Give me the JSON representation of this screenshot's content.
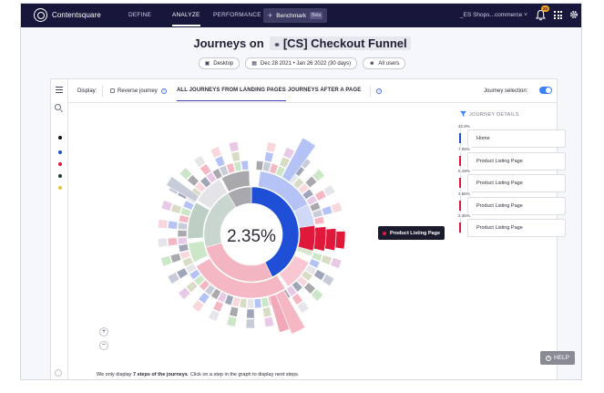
{
  "nav": {
    "brand": "Contentsquare",
    "items": [
      "DEFINE",
      "ANALYZE",
      "PERFORMANCE"
    ],
    "active": "ANALYZE",
    "benchmark": "Benchmark",
    "beta": "Beta",
    "project": "_ES Shops...commerce",
    "notification_count": "20"
  },
  "header": {
    "title_prefix": "Journeys on",
    "mapping": "[CS] Checkout Funnel",
    "filters": [
      {
        "icon": "desktop-icon",
        "label": "Desktop"
      },
      {
        "icon": "calendar-icon",
        "label": "Dec 28 2021 • Jan 26 2022 (30 days)"
      },
      {
        "icon": "users-icon",
        "label": "All users"
      }
    ]
  },
  "toolbar": {
    "display_label": "Display:",
    "reverse_label": "Reverse journey",
    "tabs": [
      "ALL JOURNEYS FROM LANDING PAGES",
      "JOURNEYS AFTER A PAGE"
    ],
    "journey_selection_label": "Journey selection:"
  },
  "colors": {
    "accent": "#3f3fb8",
    "home": "#1f4fd6",
    "product_listing": "#e0193b",
    "toggle": "#3b82f6"
  },
  "sunburst": {
    "center_value": "2.35%",
    "tooltip": "Product Listing Page"
  },
  "journey_details": {
    "title": "JOURNEY DETAILS",
    "steps": [
      {
        "pct": "42.8%",
        "label": "Home",
        "color": "#1f4fd6"
      },
      {
        "pct": "7.05%",
        "label": "Product Listing Page",
        "color": "#e0193b"
      },
      {
        "pct": "5.19%",
        "label": "Product Listing Page",
        "color": "#e0193b"
      },
      {
        "pct": "3.56%",
        "label": "Product Listing Page",
        "color": "#e0193b"
      },
      {
        "pct": "2.35%",
        "label": "Product Listing Page",
        "color": "#e0193b"
      }
    ]
  },
  "footer": {
    "note_prefix": "We only display",
    "note_bold": "7 steps of the journeys",
    "note_suffix": ". Click on a step in the graph to display next steps.",
    "help": "HELP"
  },
  "zoom": {
    "plus": "+",
    "minus": "−"
  }
}
